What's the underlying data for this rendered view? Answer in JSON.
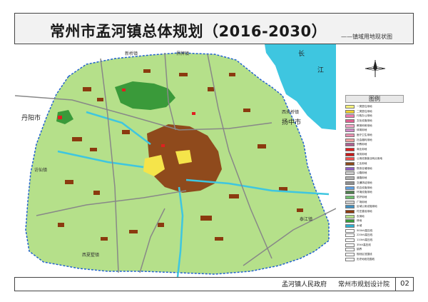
{
  "header": {
    "title": "常州市孟河镇总体规划（2016-2030）",
    "subtitle": "——镇域用地现状图"
  },
  "map": {
    "places": {
      "xinqiao": "新桥镇",
      "xiejia": "界牌镇",
      "danyang": "丹阳市",
      "yangzhong": "扬中市",
      "chang": "长",
      "jiang": "江",
      "xilai": "西来桥镇",
      "fangxian": "访仙镇",
      "taiping": "泰江镇",
      "xiawang": "西夏墅镇"
    },
    "colors": {
      "agriculture": "#b5e08a",
      "village": "#8b3a0f",
      "forest": "#3a9a3a",
      "water": "#2fb0d0",
      "river": "#3ec6e0",
      "road": "#888888",
      "yellow": "#f5e44a",
      "boundary": "#2060d0"
    }
  },
  "legend": {
    "title": "图例",
    "items": [
      {
        "label": "一类居住用地",
        "color": "#f8f27a"
      },
      {
        "label": "二类居住用地",
        "color": "#f0d030"
      },
      {
        "label": "行政办公用地",
        "color": "#f07ab0"
      },
      {
        "label": "文化设施用地",
        "color": "#e06090"
      },
      {
        "label": "教育科研用地",
        "color": "#f4a6c8"
      },
      {
        "label": "体育用地",
        "color": "#d08ac8"
      },
      {
        "label": "医疗卫生用地",
        "color": "#e890b0"
      },
      {
        "label": "社会福利用地",
        "color": "#f0a0a0"
      },
      {
        "label": "宗教用地",
        "color": "#b06090"
      },
      {
        "label": "商业用地",
        "color": "#e02020"
      },
      {
        "label": "商务用地",
        "color": "#c81818"
      },
      {
        "label": "公用设施营业网点用地",
        "color": "#f05050"
      },
      {
        "label": "工业用地",
        "color": "#8b4a1a"
      },
      {
        "label": "物流仓储用地",
        "color": "#9060c0"
      },
      {
        "label": "公路用地",
        "color": "#cccccc"
      },
      {
        "label": "道路用地",
        "color": "#b0b0b0"
      },
      {
        "label": "交通场站用地",
        "color": "#909090"
      },
      {
        "label": "供应设施用地",
        "color": "#60a0e0"
      },
      {
        "label": "环境设施用地",
        "color": "#508050"
      },
      {
        "label": "防护用地",
        "color": "#70c070"
      },
      {
        "label": "广场用地",
        "color": "#d0d0d0"
      },
      {
        "label": "区域公用设施用地",
        "color": "#4090c0"
      },
      {
        "label": "村庄建设用地",
        "color": "#8b3a0f"
      },
      {
        "label": "农用地",
        "color": "#b5e08a"
      },
      {
        "label": "林地",
        "color": "#3a9a3a"
      },
      {
        "label": "水域",
        "color": "#2fb0d0"
      },
      {
        "label": "500kV高压线",
        "color": "#ffffff"
      },
      {
        "label": "220kV高压线",
        "color": "#ffffff"
      },
      {
        "label": "110kV高压线",
        "color": "#ffffff"
      },
      {
        "label": "35kV高压线",
        "color": "#ffffff"
      },
      {
        "label": "镇界",
        "color": "#ffffff"
      },
      {
        "label": "规划区范围线",
        "color": "#ffffff"
      },
      {
        "label": "历史地段范围线",
        "color": "#ffffff"
      }
    ]
  },
  "footer": {
    "org1": "孟河镇人民政府",
    "org2": "常州市规划设计院",
    "page": "02"
  }
}
